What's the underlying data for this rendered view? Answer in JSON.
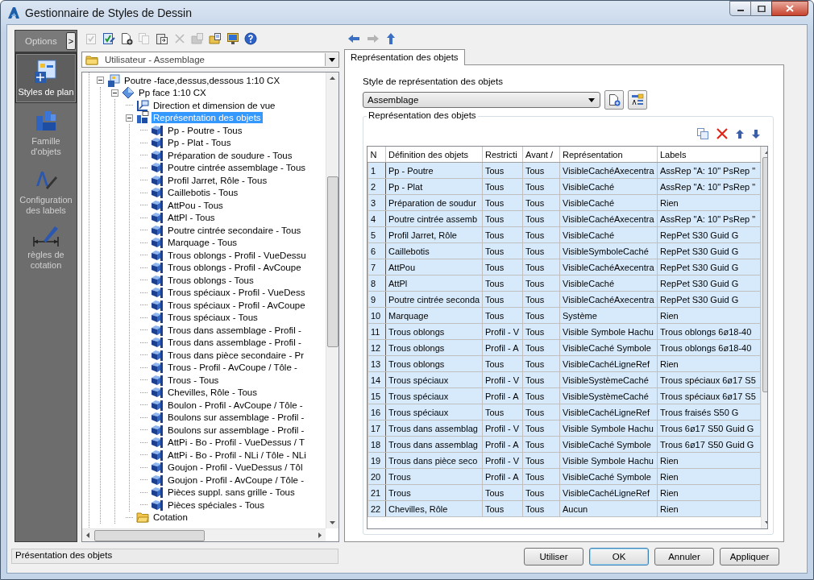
{
  "window": {
    "title": "Gestionnaire de Styles de Dessin"
  },
  "nav": {
    "header": "Options",
    "toggle": ">",
    "items": [
      {
        "label": "Styles de plan",
        "kind": "plan",
        "selected": true
      },
      {
        "label": "Famille d'objets",
        "kind": "family",
        "selected": false
      },
      {
        "label": "Configuration des labels",
        "kind": "labels",
        "selected": false
      },
      {
        "label": "règles de cotation",
        "kind": "dimension",
        "selected": false
      }
    ]
  },
  "toolbar": [
    {
      "kind": "check-doc",
      "disabled": true
    },
    {
      "kind": "edit",
      "disabled": false
    },
    {
      "kind": "new",
      "disabled": false
    },
    {
      "kind": "copy",
      "disabled": true
    },
    {
      "kind": "paste",
      "disabled": false
    },
    {
      "kind": "delete",
      "disabled": true
    },
    {
      "kind": "import",
      "disabled": true
    },
    {
      "kind": "export",
      "disabled": false
    },
    {
      "kind": "monitor",
      "disabled": false
    },
    {
      "kind": "help",
      "disabled": false
    }
  ],
  "library": {
    "value": "Utilisateur - Assemblage"
  },
  "tree": [
    {
      "label": "Poutre -face,dessus,dessous 1:10 CX",
      "kind": "style",
      "expanded": true,
      "selected": false,
      "children": [
        {
          "label": "Pp face 1:10 CX",
          "kind": "view",
          "expanded": true,
          "selected": false,
          "children": [
            {
              "label": "Direction et dimension de vue",
              "kind": "direction",
              "selected": false
            },
            {
              "label": "Représentation des objets",
              "kind": "representation",
              "expanded": true,
              "selected": true,
              "children": [
                {
                  "label": "Pp - Poutre - Tous",
                  "kind": "object",
                  "selected": false
                },
                {
                  "label": "Pp - Plat - Tous",
                  "kind": "object",
                  "selected": false
                },
                {
                  "label": "Préparation de soudure - Tous",
                  "kind": "object",
                  "selected": false
                },
                {
                  "label": "Poutre cintrée assemblage - Tous",
                  "kind": "object",
                  "selected": false
                },
                {
                  "label": "Profil Jarret, Rôle - Tous",
                  "kind": "object",
                  "selected": false
                },
                {
                  "label": "Caillebotis - Tous",
                  "kind": "object",
                  "selected": false
                },
                {
                  "label": "AttPou - Tous",
                  "kind": "object",
                  "selected": false
                },
                {
                  "label": "AttPl - Tous",
                  "kind": "object",
                  "selected": false
                },
                {
                  "label": "Poutre cintrée secondaire - Tous",
                  "kind": "object",
                  "selected": false
                },
                {
                  "label": "Marquage - Tous",
                  "kind": "object",
                  "selected": false
                },
                {
                  "label": "Trous oblongs - Profil - VueDessu",
                  "kind": "object",
                  "selected": false
                },
                {
                  "label": "Trous oblongs - Profil - AvCoupe",
                  "kind": "object",
                  "selected": false
                },
                {
                  "label": "Trous oblongs - Tous",
                  "kind": "object",
                  "selected": false
                },
                {
                  "label": "Trous spéciaux - Profil - VueDess",
                  "kind": "object",
                  "selected": false
                },
                {
                  "label": "Trous spéciaux - Profil - AvCoupe",
                  "kind": "object",
                  "selected": false
                },
                {
                  "label": "Trous spéciaux - Tous",
                  "kind": "object",
                  "selected": false
                },
                {
                  "label": "Trous dans assemblage - Profil -",
                  "kind": "object",
                  "selected": false
                },
                {
                  "label": "Trous dans assemblage - Profil -",
                  "kind": "object",
                  "selected": false
                },
                {
                  "label": "Trous dans pièce secondaire - Pr",
                  "kind": "object",
                  "selected": false
                },
                {
                  "label": "Trous - Profil - AvCoupe / Tôle -",
                  "kind": "object",
                  "selected": false
                },
                {
                  "label": "Trous - Tous",
                  "kind": "object",
                  "selected": false
                },
                {
                  "label": "Chevilles, Rôle - Tous",
                  "kind": "object",
                  "selected": false
                },
                {
                  "label": "Boulon - Profil - AvCoupe / Tôle -",
                  "kind": "object",
                  "selected": false
                },
                {
                  "label": "Boulons sur assemblage - Profil -",
                  "kind": "object",
                  "selected": false
                },
                {
                  "label": "Boulons sur assemblage - Profil -",
                  "kind": "object",
                  "selected": false
                },
                {
                  "label": "AttPi - Bo - Profil - VueDessus / T",
                  "kind": "object",
                  "selected": false
                },
                {
                  "label": "AttPi - Bo - Profil - NLi / Tôle - NLi",
                  "kind": "object",
                  "selected": false
                },
                {
                  "label": "Goujon - Profil - VueDessus / Tôl",
                  "kind": "object",
                  "selected": false
                },
                {
                  "label": "Goujon - Profil - AvCoupe / Tôle -",
                  "kind": "object",
                  "selected": false
                },
                {
                  "label": "Pièces suppl. sans grille - Tous",
                  "kind": "object",
                  "selected": false
                },
                {
                  "label": "Pièces spéciales - Tous",
                  "kind": "object",
                  "selected": false
                }
              ]
            },
            {
              "label": "Cotation",
              "kind": "folder",
              "selected": false
            }
          ]
        }
      ]
    }
  ],
  "history": [
    {
      "kind": "back",
      "disabled": false
    },
    {
      "kind": "forward",
      "disabled": true
    },
    {
      "kind": "up",
      "disabled": false
    }
  ],
  "tabs": [
    {
      "label": "Représentation des objets",
      "selected": true
    }
  ],
  "style_field": {
    "label": "Style de représentation des objets",
    "value": "Assemblage"
  },
  "group": {
    "title": "Représentation des objets",
    "columns": [
      "N",
      "Définition des objets",
      "Restricti",
      "Avant /",
      "Représentation",
      "Labels"
    ],
    "rows": [
      {
        "selected": true,
        "cells": [
          "1",
          "Pp - Poutre",
          "Tous",
          "Tous",
          "VisibleCachéAxecentra",
          "AssRep \"A: 10\" PsRep \""
        ]
      },
      {
        "selected": true,
        "cells": [
          "2",
          "Pp - Plat",
          "Tous",
          "Tous",
          "VisibleCaché",
          "AssRep \"A: 10\" PsRep \""
        ]
      },
      {
        "selected": true,
        "cells": [
          "3",
          "Préparation de soudur",
          "Tous",
          "Tous",
          "VisibleCaché",
          "Rien"
        ]
      },
      {
        "selected": true,
        "cells": [
          "4",
          "Poutre cintrée assemb",
          "Tous",
          "Tous",
          "VisibleCachéAxecentra",
          "AssRep \"A: 10\" PsRep \""
        ]
      },
      {
        "selected": true,
        "cells": [
          "5",
          "Profil Jarret, Rôle",
          "Tous",
          "Tous",
          "VisibleCaché",
          "RepPet S30 Guid G"
        ]
      },
      {
        "selected": true,
        "cells": [
          "6",
          "Caillebotis",
          "Tous",
          "Tous",
          "VisibleSymboleCaché",
          "RepPet S30 Guid G"
        ]
      },
      {
        "selected": true,
        "cells": [
          "7",
          "AttPou",
          "Tous",
          "Tous",
          "VisibleCachéAxecentra",
          "RepPet S30 Guid G"
        ]
      },
      {
        "selected": true,
        "cells": [
          "8",
          "AttPl",
          "Tous",
          "Tous",
          "VisibleCaché",
          "RepPet S30 Guid G"
        ]
      },
      {
        "selected": true,
        "cells": [
          "9",
          "Poutre cintrée seconda",
          "Tous",
          "Tous",
          "VisibleCachéAxecentra",
          "RepPet S30 Guid G"
        ]
      },
      {
        "selected": true,
        "cells": [
          "10",
          "Marquage",
          "Tous",
          "Tous",
          "Système",
          "Rien"
        ]
      },
      {
        "selected": true,
        "cells": [
          "11",
          "Trous oblongs",
          "Profil - V",
          "Tous",
          "Visible Symbole Hachu",
          "Trous oblongs 6ø18-40"
        ]
      },
      {
        "selected": true,
        "cells": [
          "12",
          "Trous oblongs",
          "Profil - A",
          "Tous",
          "VisibleCaché Symbole",
          "Trous oblongs 6ø18-40"
        ]
      },
      {
        "selected": true,
        "cells": [
          "13",
          "Trous oblongs",
          "Tous",
          "Tous",
          "VisibleCachéLigneRef",
          "Rien"
        ]
      },
      {
        "selected": true,
        "cells": [
          "14",
          "Trous spéciaux",
          "Profil - V",
          "Tous",
          "VisibleSystèmeCaché",
          "Trous spéciaux 6ø17 S5"
        ]
      },
      {
        "selected": true,
        "cells": [
          "15",
          "Trous spéciaux",
          "Profil - A",
          "Tous",
          "VisibleSystèmeCaché",
          "Trous spéciaux 6ø17 S5"
        ]
      },
      {
        "selected": true,
        "cells": [
          "16",
          "Trous spéciaux",
          "Tous",
          "Tous",
          "VisibleCachéLigneRef",
          "Trous fraisés S50 G"
        ]
      },
      {
        "selected": true,
        "cells": [
          "17",
          "Trous dans assemblag",
          "Profil - V",
          "Tous",
          "Visible Symbole Hachu",
          "Trous 6ø17 S50 Guid G"
        ]
      },
      {
        "selected": true,
        "cells": [
          "18",
          "Trous dans assemblag",
          "Profil - A",
          "Tous",
          "VisibleCaché Symbole",
          "Trous 6ø17 S50 Guid G"
        ]
      },
      {
        "selected": true,
        "cells": [
          "19",
          "Trous dans pièce seco",
          "Profil - V",
          "Tous",
          "Visible Symbole Hachu",
          "Rien"
        ]
      },
      {
        "selected": true,
        "cells": [
          "20",
          "Trous",
          "Profil - A",
          "Tous",
          "VisibleCaché Symbole",
          "Rien"
        ]
      },
      {
        "selected": true,
        "cells": [
          "21",
          "Trous",
          "Tous",
          "Tous",
          "VisibleCachéLigneRef",
          "Rien"
        ]
      },
      {
        "selected": true,
        "cells": [
          "22",
          "Chevilles, Rôle",
          "Tous",
          "Tous",
          "Aucun",
          "Rien"
        ]
      }
    ]
  },
  "status": "Présentation des objets",
  "buttons": [
    {
      "label": "Utiliser",
      "default": false
    },
    {
      "label": "OK",
      "default": true
    },
    {
      "label": "Annuler",
      "default": false
    },
    {
      "label": "Appliquer",
      "default": false
    }
  ]
}
